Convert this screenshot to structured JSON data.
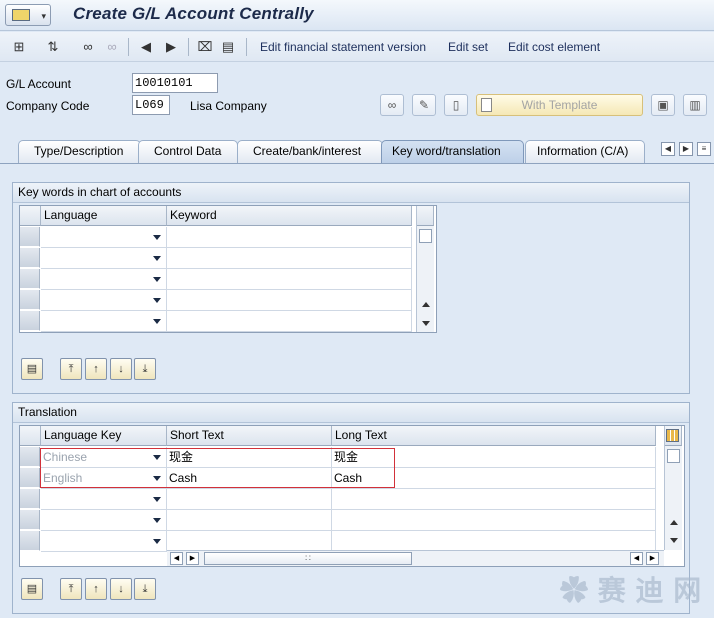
{
  "window": {
    "title": "Create G/L Account Centrally"
  },
  "toolbar": {
    "links": [
      "Edit financial statement version",
      "Edit set",
      "Edit cost element"
    ]
  },
  "header": {
    "gl_account_label": "G/L Account",
    "gl_account_value": "10010101",
    "company_code_label": "Company Code",
    "company_code_value": "L069",
    "company_name": "Lisa Company",
    "with_template_label": "With Template"
  },
  "tabs": [
    {
      "label": "Type/Description",
      "active": false
    },
    {
      "label": "Control Data",
      "active": false
    },
    {
      "label": "Create/bank/interest",
      "active": false
    },
    {
      "label": "Key word/translation",
      "active": true
    },
    {
      "label": "Information (C/A)",
      "active": false
    }
  ],
  "keywords_group": {
    "title": "Key words in chart of accounts",
    "columns": [
      "Language",
      "Keyword"
    ],
    "rows": [
      {
        "language": "",
        "keyword": ""
      },
      {
        "language": "",
        "keyword": ""
      },
      {
        "language": "",
        "keyword": ""
      },
      {
        "language": "",
        "keyword": ""
      },
      {
        "language": "",
        "keyword": ""
      }
    ]
  },
  "translation_group": {
    "title": "Translation",
    "columns": [
      "Language Key",
      "Short Text",
      "Long Text"
    ],
    "rows": [
      {
        "language": "Chinese",
        "short": "现金",
        "long": "现金"
      },
      {
        "language": "English",
        "short": "Cash",
        "long": "Cash"
      },
      {
        "language": "",
        "short": "",
        "long": ""
      },
      {
        "language": "",
        "short": "",
        "long": ""
      },
      {
        "language": "",
        "short": "",
        "long": ""
      }
    ]
  },
  "colors": {
    "background": "#dfe9f5",
    "highlight_border": "#d2313a",
    "title_text": "#1c2a4a"
  }
}
